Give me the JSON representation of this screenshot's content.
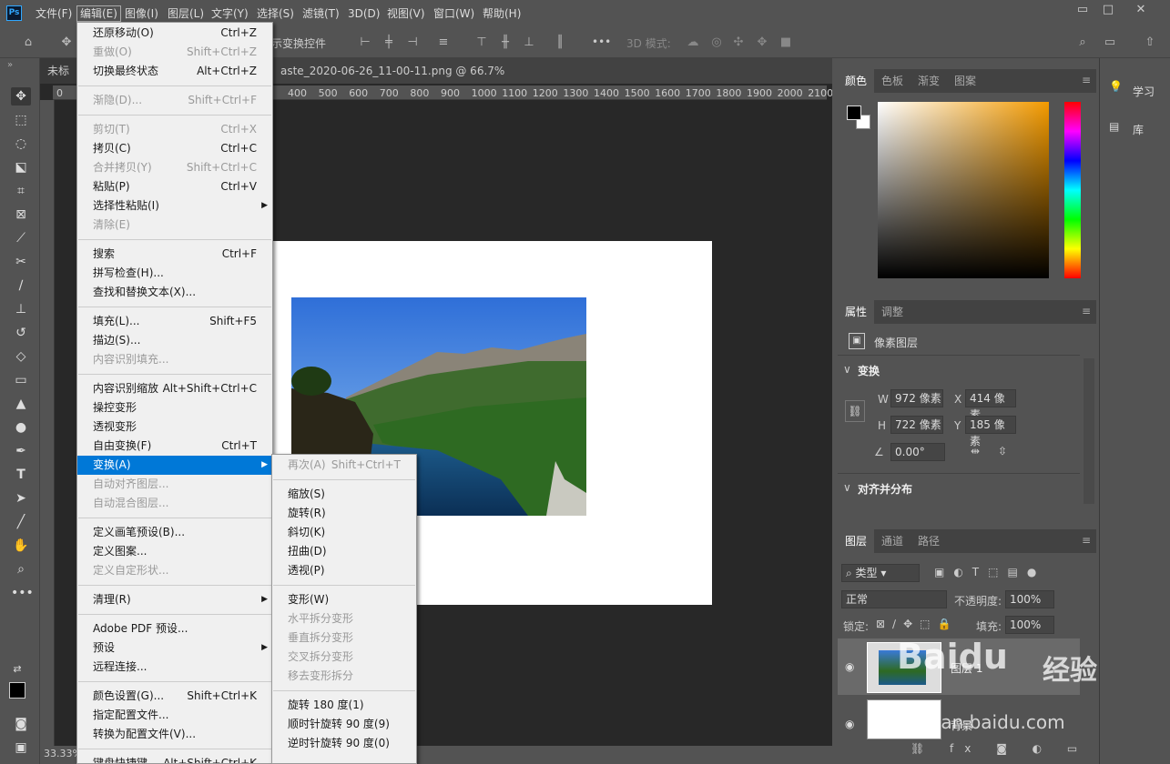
{
  "app": {
    "logo": "Ps"
  },
  "menubar": {
    "items": [
      "文件(F)",
      "编辑(E)",
      "图像(I)",
      "图层(L)",
      "文字(Y)",
      "选择(S)",
      "滤镜(T)",
      "3D(D)",
      "视图(V)",
      "窗口(W)",
      "帮助(H)"
    ],
    "window_controls": {
      "minimize": "▭",
      "restore": "□",
      "close": "✕"
    }
  },
  "options": {
    "transform_controls": "示变换控件",
    "mode_3d": "3D 模式:",
    "more": "•••"
  },
  "tab": {
    "doc1": "未标题",
    "doc2": "aste_2020-06-26_11-00-11.png @ 66.7%(RGB/8)",
    "close": "×"
  },
  "ruler": {
    "h": [
      "0",
      "400",
      "500",
      "600",
      "700",
      "800",
      "900",
      "1000",
      "1100",
      "1200",
      "1300",
      "1400",
      "1500",
      "1600",
      "1700",
      "1800",
      "1900",
      "2000",
      "2100",
      "210"
    ]
  },
  "status": {
    "zoom": "33.33%"
  },
  "edit_menu": [
    {
      "label": "还原移动(O)",
      "shortcut": "Ctrl+Z",
      "enabled": true
    },
    {
      "label": "重做(O)",
      "shortcut": "Shift+Ctrl+Z",
      "enabled": false
    },
    {
      "label": "切换最终状态",
      "shortcut": "Alt+Ctrl+Z",
      "enabled": true
    },
    {
      "sep": true
    },
    {
      "label": "渐隐(D)...",
      "shortcut": "Shift+Ctrl+F",
      "enabled": false
    },
    {
      "sep": true
    },
    {
      "label": "剪切(T)",
      "shortcut": "Ctrl+X",
      "enabled": false
    },
    {
      "label": "拷贝(C)",
      "shortcut": "Ctrl+C",
      "enabled": true
    },
    {
      "label": "合并拷贝(Y)",
      "shortcut": "Shift+Ctrl+C",
      "enabled": false
    },
    {
      "label": "粘贴(P)",
      "shortcut": "Ctrl+V",
      "enabled": true
    },
    {
      "label": "选择性粘贴(I)",
      "shortcut": "",
      "enabled": true,
      "sub": true
    },
    {
      "label": "清除(E)",
      "shortcut": "",
      "enabled": false
    },
    {
      "sep": true
    },
    {
      "label": "搜索",
      "shortcut": "Ctrl+F",
      "enabled": true
    },
    {
      "label": "拼写检查(H)...",
      "shortcut": "",
      "enabled": true
    },
    {
      "label": "查找和替换文本(X)...",
      "shortcut": "",
      "enabled": true
    },
    {
      "sep": true
    },
    {
      "label": "填充(L)...",
      "shortcut": "Shift+F5",
      "enabled": true
    },
    {
      "label": "描边(S)...",
      "shortcut": "",
      "enabled": true
    },
    {
      "label": "内容识别填充...",
      "shortcut": "",
      "enabled": false
    },
    {
      "sep": true
    },
    {
      "label": "内容识别缩放",
      "shortcut": "Alt+Shift+Ctrl+C",
      "enabled": true
    },
    {
      "label": "操控变形",
      "shortcut": "",
      "enabled": true
    },
    {
      "label": "透视变形",
      "shortcut": "",
      "enabled": true
    },
    {
      "label": "自由变换(F)",
      "shortcut": "Ctrl+T",
      "enabled": true
    },
    {
      "label": "变换(A)",
      "shortcut": "",
      "enabled": true,
      "sub": true,
      "highlight": true
    },
    {
      "label": "自动对齐图层...",
      "shortcut": "",
      "enabled": false
    },
    {
      "label": "自动混合图层...",
      "shortcut": "",
      "enabled": false
    },
    {
      "sep": true
    },
    {
      "label": "定义画笔预设(B)...",
      "shortcut": "",
      "enabled": true
    },
    {
      "label": "定义图案...",
      "shortcut": "",
      "enabled": true
    },
    {
      "label": "定义自定形状...",
      "shortcut": "",
      "enabled": false
    },
    {
      "sep": true
    },
    {
      "label": "清理(R)",
      "shortcut": "",
      "enabled": true,
      "sub": true
    },
    {
      "sep": true
    },
    {
      "label": "Adobe PDF 预设...",
      "shortcut": "",
      "enabled": true
    },
    {
      "label": "预设",
      "shortcut": "",
      "enabled": true,
      "sub": true
    },
    {
      "label": "远程连接...",
      "shortcut": "",
      "enabled": true
    },
    {
      "sep": true
    },
    {
      "label": "颜色设置(G)...",
      "shortcut": "Shift+Ctrl+K",
      "enabled": true
    },
    {
      "label": "指定配置文件...",
      "shortcut": "",
      "enabled": true
    },
    {
      "label": "转换为配置文件(V)...",
      "shortcut": "",
      "enabled": true
    },
    {
      "sep": true
    },
    {
      "label": "键盘快捷键...",
      "shortcut": "Alt+Shift+Ctrl+K",
      "enabled": true
    }
  ],
  "transform_menu": [
    {
      "label": "再次(A)",
      "shortcut": "Shift+Ctrl+T",
      "enabled": false
    },
    {
      "sep": true
    },
    {
      "label": "缩放(S)",
      "enabled": true
    },
    {
      "label": "旋转(R)",
      "enabled": true
    },
    {
      "label": "斜切(K)",
      "enabled": true
    },
    {
      "label": "扭曲(D)",
      "enabled": true
    },
    {
      "label": "透视(P)",
      "enabled": true
    },
    {
      "sep": true
    },
    {
      "label": "变形(W)",
      "enabled": true
    },
    {
      "label": "水平拆分变形",
      "enabled": false
    },
    {
      "label": "垂直拆分变形",
      "enabled": false
    },
    {
      "label": "交叉拆分变形",
      "enabled": false
    },
    {
      "label": "移去变形拆分",
      "enabled": false
    },
    {
      "sep": true
    },
    {
      "label": "旋转 180 度(1)",
      "enabled": true
    },
    {
      "label": "顺时针旋转 90 度(9)",
      "enabled": true
    },
    {
      "label": "逆时针旋转 90 度(0)",
      "enabled": true
    }
  ],
  "color_panel": {
    "tabs": [
      "颜色",
      "色板",
      "渐变",
      "图案"
    ]
  },
  "properties_panel": {
    "tabs": [
      "属性",
      "调整"
    ],
    "layer_type": "像素图层",
    "transform_section": "变换",
    "w_label": "W",
    "w": "972 像素",
    "h_label": "H",
    "h": "722 像素",
    "x_label": "X",
    "x": "414 像素",
    "y_label": "Y",
    "y": "185 像素",
    "angle": "0.00°",
    "align_section": "对齐并分布"
  },
  "layers_panel": {
    "tabs": [
      "图层",
      "通道",
      "路径"
    ],
    "filter": "类型",
    "blend": "正常",
    "opacity_label": "不透明度:",
    "opacity": "100%",
    "lock_label": "锁定:",
    "fill_label": "填充:",
    "fill": "100%",
    "layers": [
      {
        "name": "图层 1"
      },
      {
        "name": "背景"
      }
    ]
  },
  "side_panels": {
    "learn": "学习",
    "library": "库"
  },
  "watermark": {
    "brand": "Baidu",
    "brand_cn": "经验",
    "url": "jingyan.baidu.com"
  },
  "colors": {
    "highlight": "#0078d7",
    "bg": "#535353",
    "canvas": "#282828"
  }
}
